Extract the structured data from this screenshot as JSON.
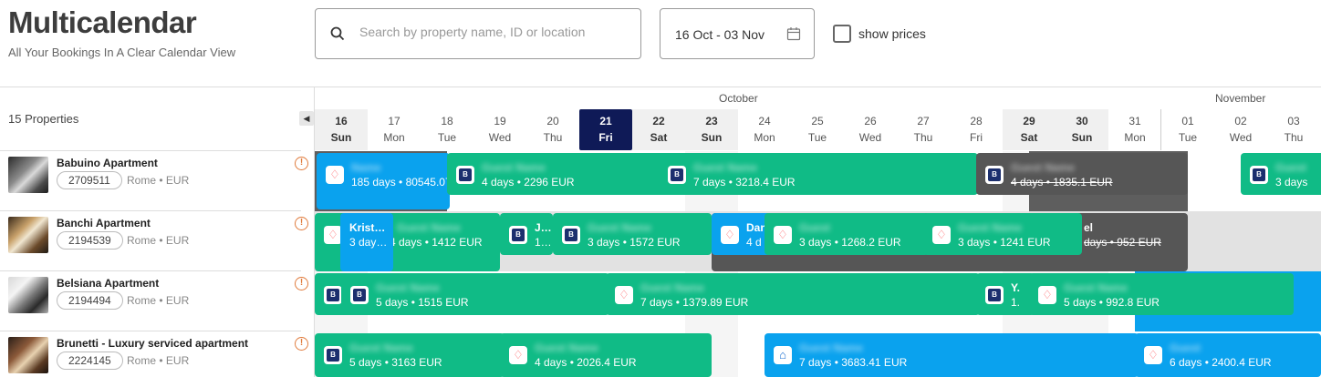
{
  "header": {
    "title": "Multicalendar",
    "subtitle": "All Your Bookings In A Clear Calendar View",
    "search_placeholder": "Search by property name, ID or location",
    "search_value": "",
    "date_range": "16 Oct - 03 Nov",
    "show_prices_label": "show prices",
    "show_prices_checked": false
  },
  "sidebar": {
    "properties_count": "15 Properties",
    "collapse_icon": "chevron-left-icon",
    "properties": [
      {
        "name": "Babuino Apartment",
        "id": "2709511",
        "city": "Rome",
        "currency": "EUR",
        "separator": "•"
      },
      {
        "name": "Banchi Apartment",
        "id": "2194539",
        "city": "Rome",
        "currency": "EUR",
        "separator": "•"
      },
      {
        "name": "Belsiana Apartment",
        "id": "2194494",
        "city": "Rome",
        "currency": "EUR",
        "separator": "•"
      },
      {
        "name": "Brunetti - Luxury serviced apartment",
        "id": "2224145",
        "city": "Rome",
        "currency": "EUR",
        "separator": "•"
      }
    ]
  },
  "calendar": {
    "months": {
      "october": "October",
      "november": "November"
    },
    "days": [
      {
        "n": "16",
        "w": "Sun"
      },
      {
        "n": "17",
        "w": "Mon"
      },
      {
        "n": "18",
        "w": "Tue"
      },
      {
        "n": "19",
        "w": "Wed"
      },
      {
        "n": "20",
        "w": "Thu"
      },
      {
        "n": "21",
        "w": "Fri"
      },
      {
        "n": "22",
        "w": "Sat"
      },
      {
        "n": "23",
        "w": "Sun"
      },
      {
        "n": "24",
        "w": "Mon"
      },
      {
        "n": "25",
        "w": "Tue"
      },
      {
        "n": "26",
        "w": "Wed"
      },
      {
        "n": "27",
        "w": "Thu"
      },
      {
        "n": "28",
        "w": "Fri"
      },
      {
        "n": "29",
        "w": "Sat"
      },
      {
        "n": "30",
        "w": "Sun"
      },
      {
        "n": "31",
        "w": "Mon"
      },
      {
        "n": "01",
        "w": "Tue"
      },
      {
        "n": "02",
        "w": "Wed"
      },
      {
        "n": "03",
        "w": "Thu"
      }
    ],
    "today": "21 Fri",
    "bookings": {
      "b1": {
        "guest": "Name",
        "info": "185 days • 80545.07 EUR"
      },
      "b2": {
        "guest": "Guest Name",
        "info": "4 days • 2296 EUR"
      },
      "b3": {
        "guest": "Guest Name",
        "info": "7 days • 3218.4 EUR"
      },
      "b4": {
        "guest": "Guest Name",
        "info": "4 days • 1835.1 EUR"
      },
      "b5": {
        "guest": "Guest",
        "info": "3 days"
      },
      "c1": {
        "guest": "Krist…",
        "info": "3 day…"
      },
      "c2": {
        "guest": "Guest Name",
        "info": "4 days • 1412 EUR"
      },
      "c3": {
        "guest": "J…",
        "info": "1…"
      },
      "c4": {
        "guest": "Guest Name",
        "info": "3 days • 1572 EUR"
      },
      "c5": {
        "guest": "Dan",
        "info": "4 d"
      },
      "c6": {
        "guest": "Guest",
        "info": "3 days • 1268.2 EUR"
      },
      "c7": {
        "guest": "Guest Name",
        "info": "3 days • 1241 EUR"
      },
      "c8": {
        "guest": "el",
        "info": "days • 952 EUR"
      },
      "d1": {
        "guest": "Guest Name",
        "info": "5 days • 1515 EUR"
      },
      "d2": {
        "guest": "Guest Name",
        "info": "7 days • 1379.89 EUR"
      },
      "d3": {
        "guest": "Y.",
        "info": "1."
      },
      "d4": {
        "guest": "Guest Name",
        "info": "5 days • 992.8 EUR"
      },
      "e1": {
        "guest": "Guest Name",
        "info": "5 days • 3163 EUR"
      },
      "e2": {
        "guest": "Guest Name",
        "info": "4 days • 2026.4 EUR"
      },
      "e3": {
        "guest": "Guest Name",
        "info": "7 days • 3683.41 EUR"
      },
      "e4": {
        "guest": "Guest",
        "info": "6 days • 2400.4 EUR"
      }
    }
  }
}
